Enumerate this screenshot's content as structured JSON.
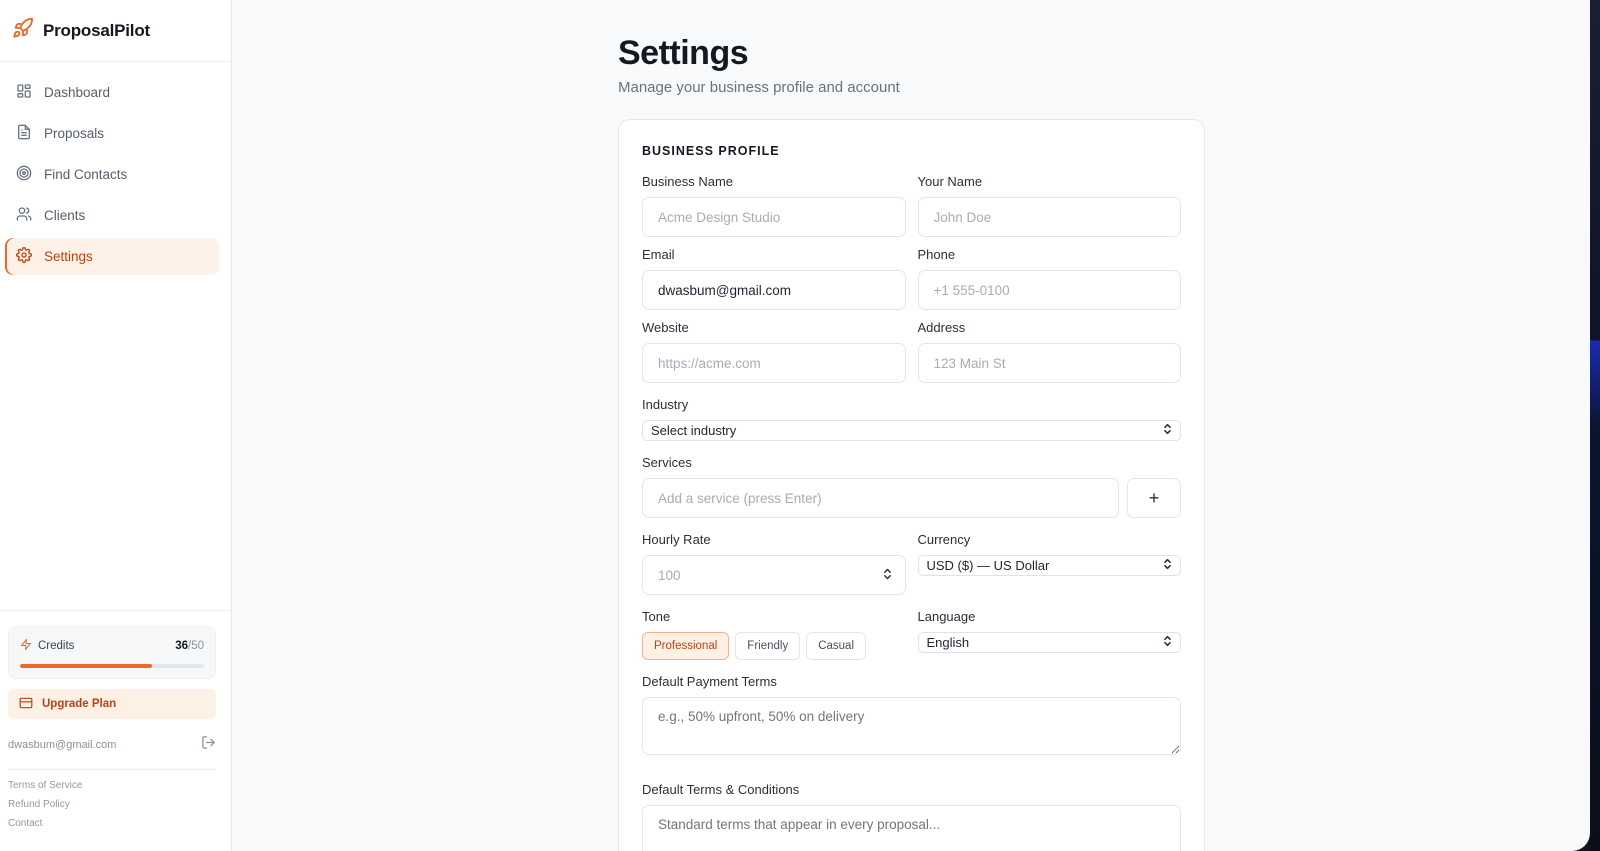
{
  "app": {
    "name": "ProposalPilot",
    "accent": "#ea6a2a"
  },
  "sidebar": {
    "items": [
      {
        "label": "Dashboard",
        "icon": "dashboard-icon",
        "active": false
      },
      {
        "label": "Proposals",
        "icon": "document-icon",
        "active": false
      },
      {
        "label": "Find Contacts",
        "icon": "target-icon",
        "active": false
      },
      {
        "label": "Clients",
        "icon": "users-icon",
        "active": false
      },
      {
        "label": "Settings",
        "icon": "gear-icon",
        "active": true
      }
    ],
    "credits": {
      "label": "Credits",
      "used": "36",
      "total": "/50",
      "fraction": 0.72
    },
    "upgrade_label": "Upgrade Plan",
    "account_email": "dwasbum@gmail.com",
    "footer_links": [
      "Terms of Service",
      "Refund Policy",
      "Contact"
    ]
  },
  "page": {
    "title": "Settings",
    "subtitle": "Manage your business profile and account"
  },
  "business_profile": {
    "section_title": "BUSINESS PROFILE",
    "business_name": {
      "label": "Business Name",
      "value": "",
      "placeholder": "Acme Design Studio"
    },
    "your_name": {
      "label": "Your Name",
      "value": "",
      "placeholder": "John Doe"
    },
    "email": {
      "label": "Email",
      "value": "dwasbum@gmail.com",
      "placeholder": ""
    },
    "phone": {
      "label": "Phone",
      "value": "",
      "placeholder": "+1 555-0100"
    },
    "website": {
      "label": "Website",
      "value": "",
      "placeholder": "https://acme.com"
    },
    "address": {
      "label": "Address",
      "value": "",
      "placeholder": "123 Main St"
    },
    "industry": {
      "label": "Industry",
      "selected": "Select industry"
    },
    "services": {
      "label": "Services",
      "placeholder": "Add a service (press Enter)",
      "add_label": "+"
    },
    "hourly_rate": {
      "label": "Hourly Rate",
      "value": "",
      "placeholder": "100"
    },
    "currency": {
      "label": "Currency",
      "selected": "USD ($) — US Dollar"
    },
    "tone": {
      "label": "Tone",
      "options": [
        "Professional",
        "Friendly",
        "Casual"
      ],
      "selected": "Professional"
    },
    "language": {
      "label": "Language",
      "selected": "English"
    },
    "payment_terms": {
      "label": "Default Payment Terms",
      "placeholder": "e.g., 50% upfront, 50% on delivery"
    },
    "terms_conditions": {
      "label": "Default Terms & Conditions",
      "placeholder": "Standard terms that appear in every proposal..."
    }
  }
}
